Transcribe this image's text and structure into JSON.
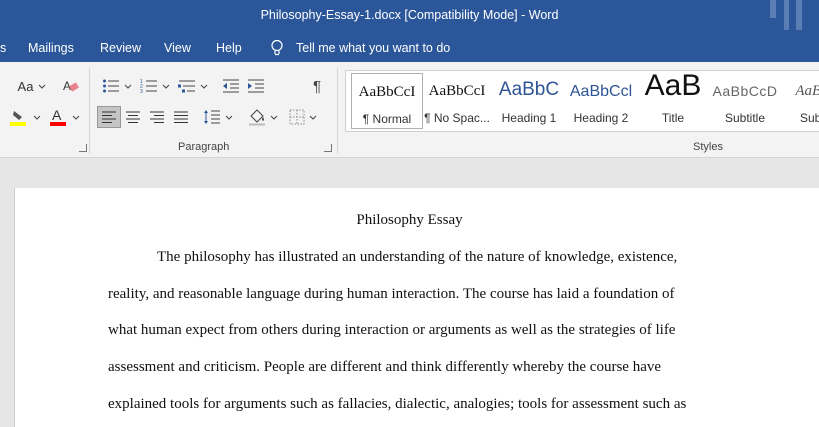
{
  "window": {
    "title": "Philosophy-Essay-1.docx  [Compatibility Mode]  -  Word"
  },
  "tabs": [
    {
      "label": "s"
    },
    {
      "label": "Mailings"
    },
    {
      "label": "Review"
    },
    {
      "label": "View"
    },
    {
      "label": "Help"
    }
  ],
  "tell_me": {
    "placeholder": "Tell me what you want to do"
  },
  "ribbon": {
    "font": {
      "change_case_label": "Aa"
    },
    "groups": {
      "paragraph": "Paragraph",
      "styles": "Styles"
    },
    "styles": [
      {
        "sample": "AaBbCcI",
        "name": "¶ Normal",
        "selected": true
      },
      {
        "sample": "AaBbCcI",
        "name": "¶ No Spac..."
      },
      {
        "sample": "AaBbC",
        "name": "Heading 1"
      },
      {
        "sample": "AaBbCcl",
        "name": "Heading 2"
      },
      {
        "sample": "AaB",
        "name": "Title"
      },
      {
        "sample": "AaBbCcD",
        "name": "Subtitle"
      },
      {
        "sample": "AaBbC",
        "name": "Subtle"
      }
    ]
  },
  "colors": {
    "word_blue": "#2b579a",
    "highlight": "#ffff00",
    "font_color": "#ff0000",
    "heading": "#2f5496"
  },
  "document": {
    "title": "Philosophy Essay",
    "lines": [
      "The philosophy has illustrated an understanding of the nature of knowledge, existence,",
      "reality, and reasonable language during human interaction. The course has laid a foundation of",
      "what human expect from others during interaction or arguments as well as the strategies of life",
      "assessment and criticism. People are different and think differently whereby the course have",
      "explained tools for arguments such as fallacies, dialectic, analogies; tools for assessment such as"
    ]
  }
}
